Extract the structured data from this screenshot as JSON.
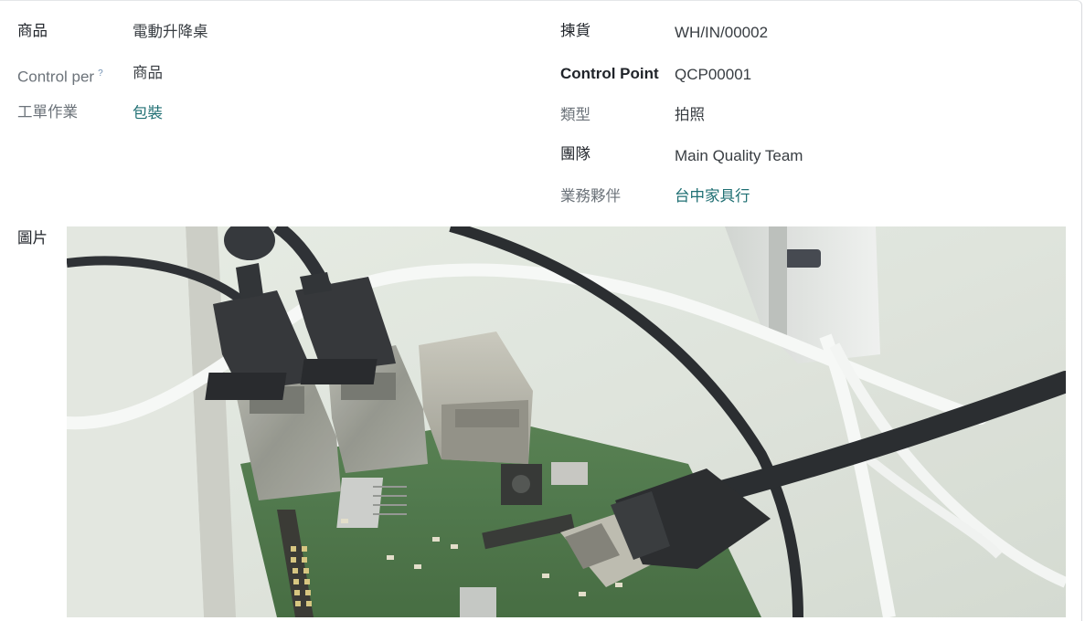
{
  "left": {
    "product_label": "商品",
    "product_value": "電動升降桌",
    "control_per_label": "Control per",
    "control_per_help": "?",
    "control_per_value": "商品",
    "operation_label": "工單作業",
    "operation_value": "包裝"
  },
  "right": {
    "picking_label": "揀貨",
    "picking_value": "WH/IN/00002",
    "control_point_label": "Control Point",
    "control_point_value": "QCP00001",
    "type_label": "類型",
    "type_value": "拍照",
    "team_label": "團隊",
    "team_value": "Main Quality Team",
    "partner_label": "業務夥伴",
    "partner_value": "台中家具行"
  },
  "picture": {
    "label": "圖片",
    "subject": "raspberry-pi-board-photo"
  }
}
